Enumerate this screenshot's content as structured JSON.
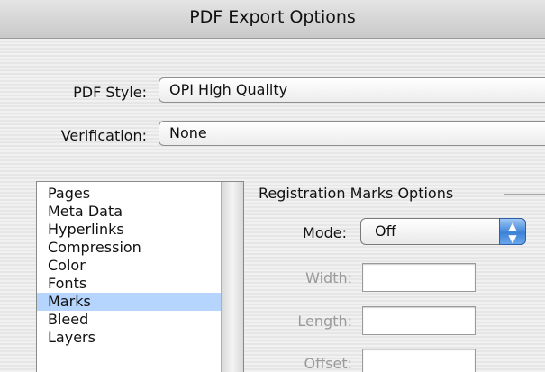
{
  "window": {
    "title": "PDF Export Options"
  },
  "pdf_style": {
    "label": "PDF Style:",
    "value": "OPI High Quality"
  },
  "verification": {
    "label": "Verification:",
    "value": "None"
  },
  "categories": {
    "items": [
      "Pages",
      "Meta Data",
      "Hyperlinks",
      "Compression",
      "Color",
      "Fonts",
      "Marks",
      "Bleed",
      "Layers"
    ],
    "selected": "Marks"
  },
  "registration": {
    "group_title": "Registration Marks Options",
    "mode_label": "Mode:",
    "mode_value": "Off",
    "width_label": "Width:",
    "width_value": "",
    "length_label": "Length:",
    "length_value": "",
    "offset_label": "Offset:",
    "offset_value": ""
  },
  "icons": {
    "stepper": "up-down-arrows-icon"
  },
  "colors": {
    "selection": "#b5d5ff",
    "stepper_accent": "#3c82d8",
    "disabled_text": "#9a9a9a"
  }
}
